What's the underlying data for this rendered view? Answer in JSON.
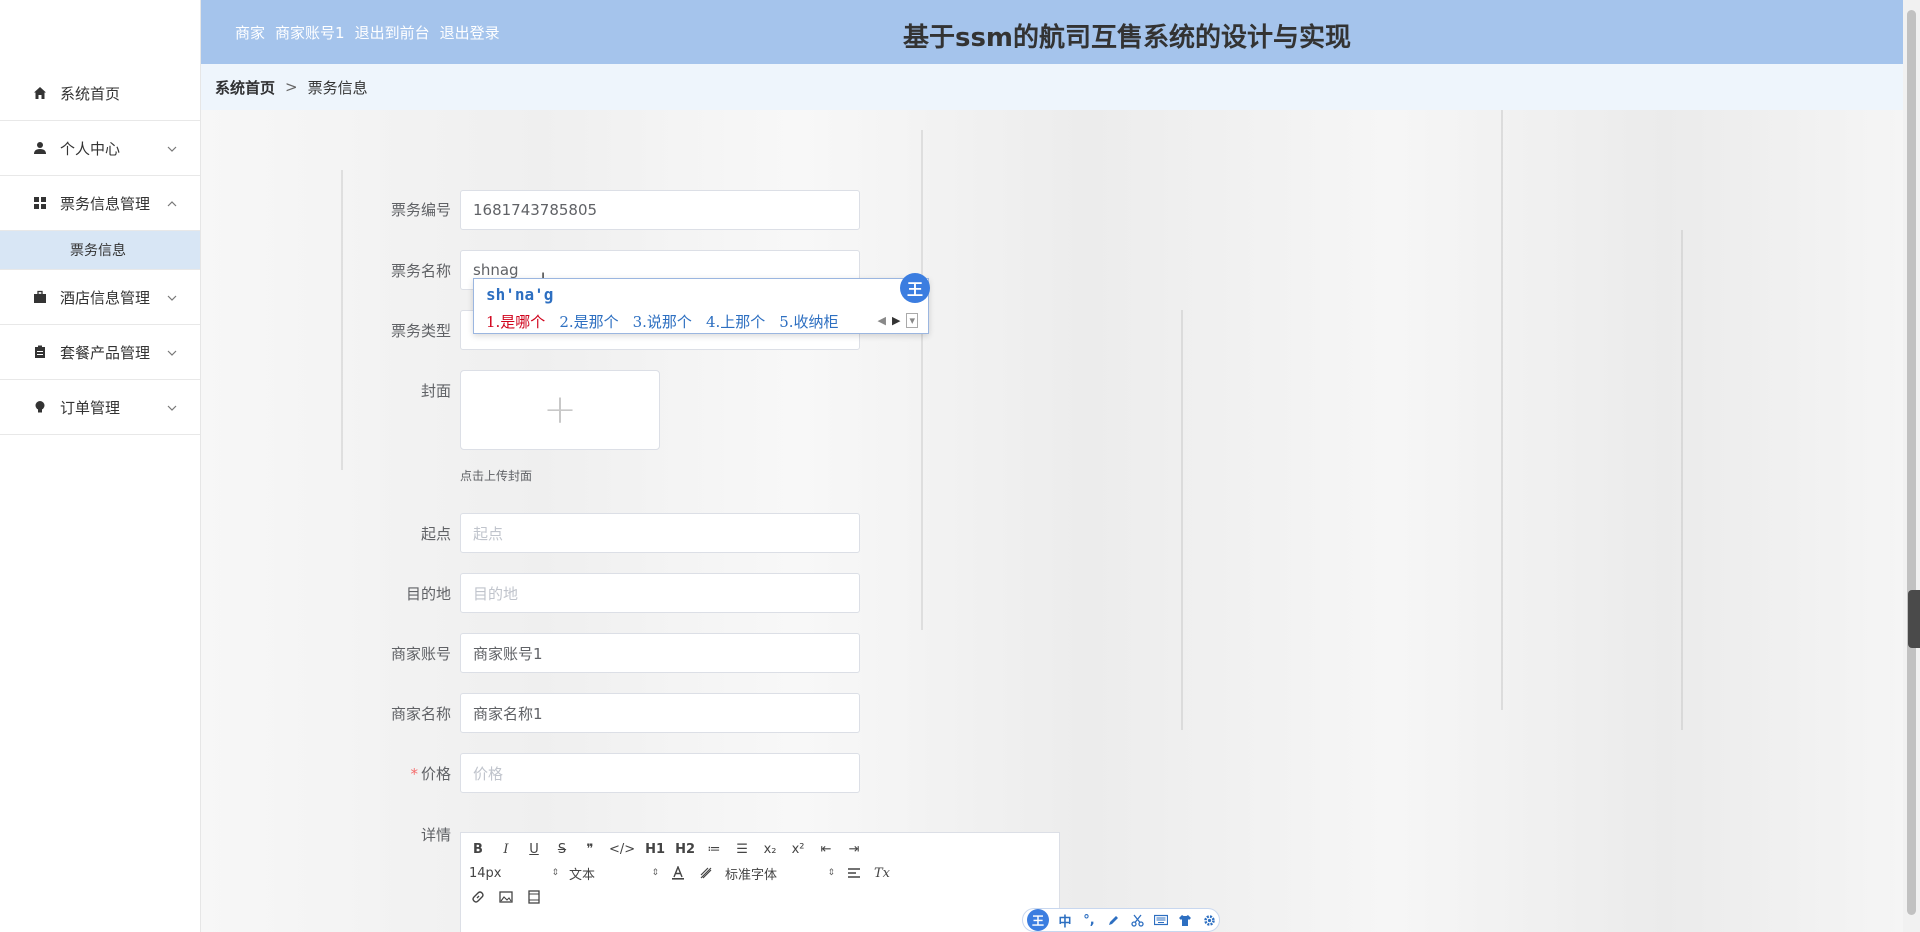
{
  "header": {
    "role": "商家",
    "username": "商家账号1",
    "to_front": "退出到前台",
    "logout": "退出登录",
    "title": "基于ssm的航司互售系统的设计与实现"
  },
  "sidebar": {
    "items": [
      {
        "label": "系统首页"
      },
      {
        "label": "个人中心"
      },
      {
        "label": "票务信息管理"
      },
      {
        "label": "酒店信息管理"
      },
      {
        "label": "套餐产品管理"
      },
      {
        "label": "订单管理"
      }
    ],
    "sub_active": "票务信息"
  },
  "breadcrumb": {
    "home": "系统首页",
    "sep": ">",
    "current": "票务信息"
  },
  "form": {
    "ticket_no": {
      "label": "票务编号",
      "value": "1681743785805"
    },
    "ticket_name": {
      "label": "票务名称",
      "value": "shnag"
    },
    "ticket_type": {
      "label": "票务类型"
    },
    "cover": {
      "label": "封面",
      "tip": "点击上传封面",
      "plus": "+"
    },
    "origin": {
      "label": "起点",
      "placeholder": "起点"
    },
    "destination": {
      "label": "目的地",
      "placeholder": "目的地"
    },
    "merchant_account": {
      "label": "商家账号",
      "value": "商家账号1"
    },
    "merchant_name": {
      "label": "商家名称",
      "value": "商家名称1"
    },
    "price": {
      "label": "价格",
      "required": "*",
      "placeholder": "价格"
    },
    "detail": {
      "label": "详情"
    }
  },
  "editor": {
    "toolbar_row1": [
      "B",
      "I",
      "U",
      "S",
      "❞",
      "</>",
      "H1",
      "H2",
      "≔",
      "☰",
      "x₂",
      "x²",
      "⇤",
      "⇥"
    ],
    "font_size": "14px",
    "block_type": "文本",
    "font_family": "标准字体",
    "clear": "Tx"
  },
  "ime": {
    "composition": "sh'na'g",
    "candidates": [
      "1.是哪个",
      "2.是那个",
      "3.说那个",
      "4.上那个",
      "5.收纳柜"
    ],
    "logo": "王"
  },
  "ime_bar": {
    "logo": "王",
    "mode": "中",
    "punct": "°,"
  }
}
